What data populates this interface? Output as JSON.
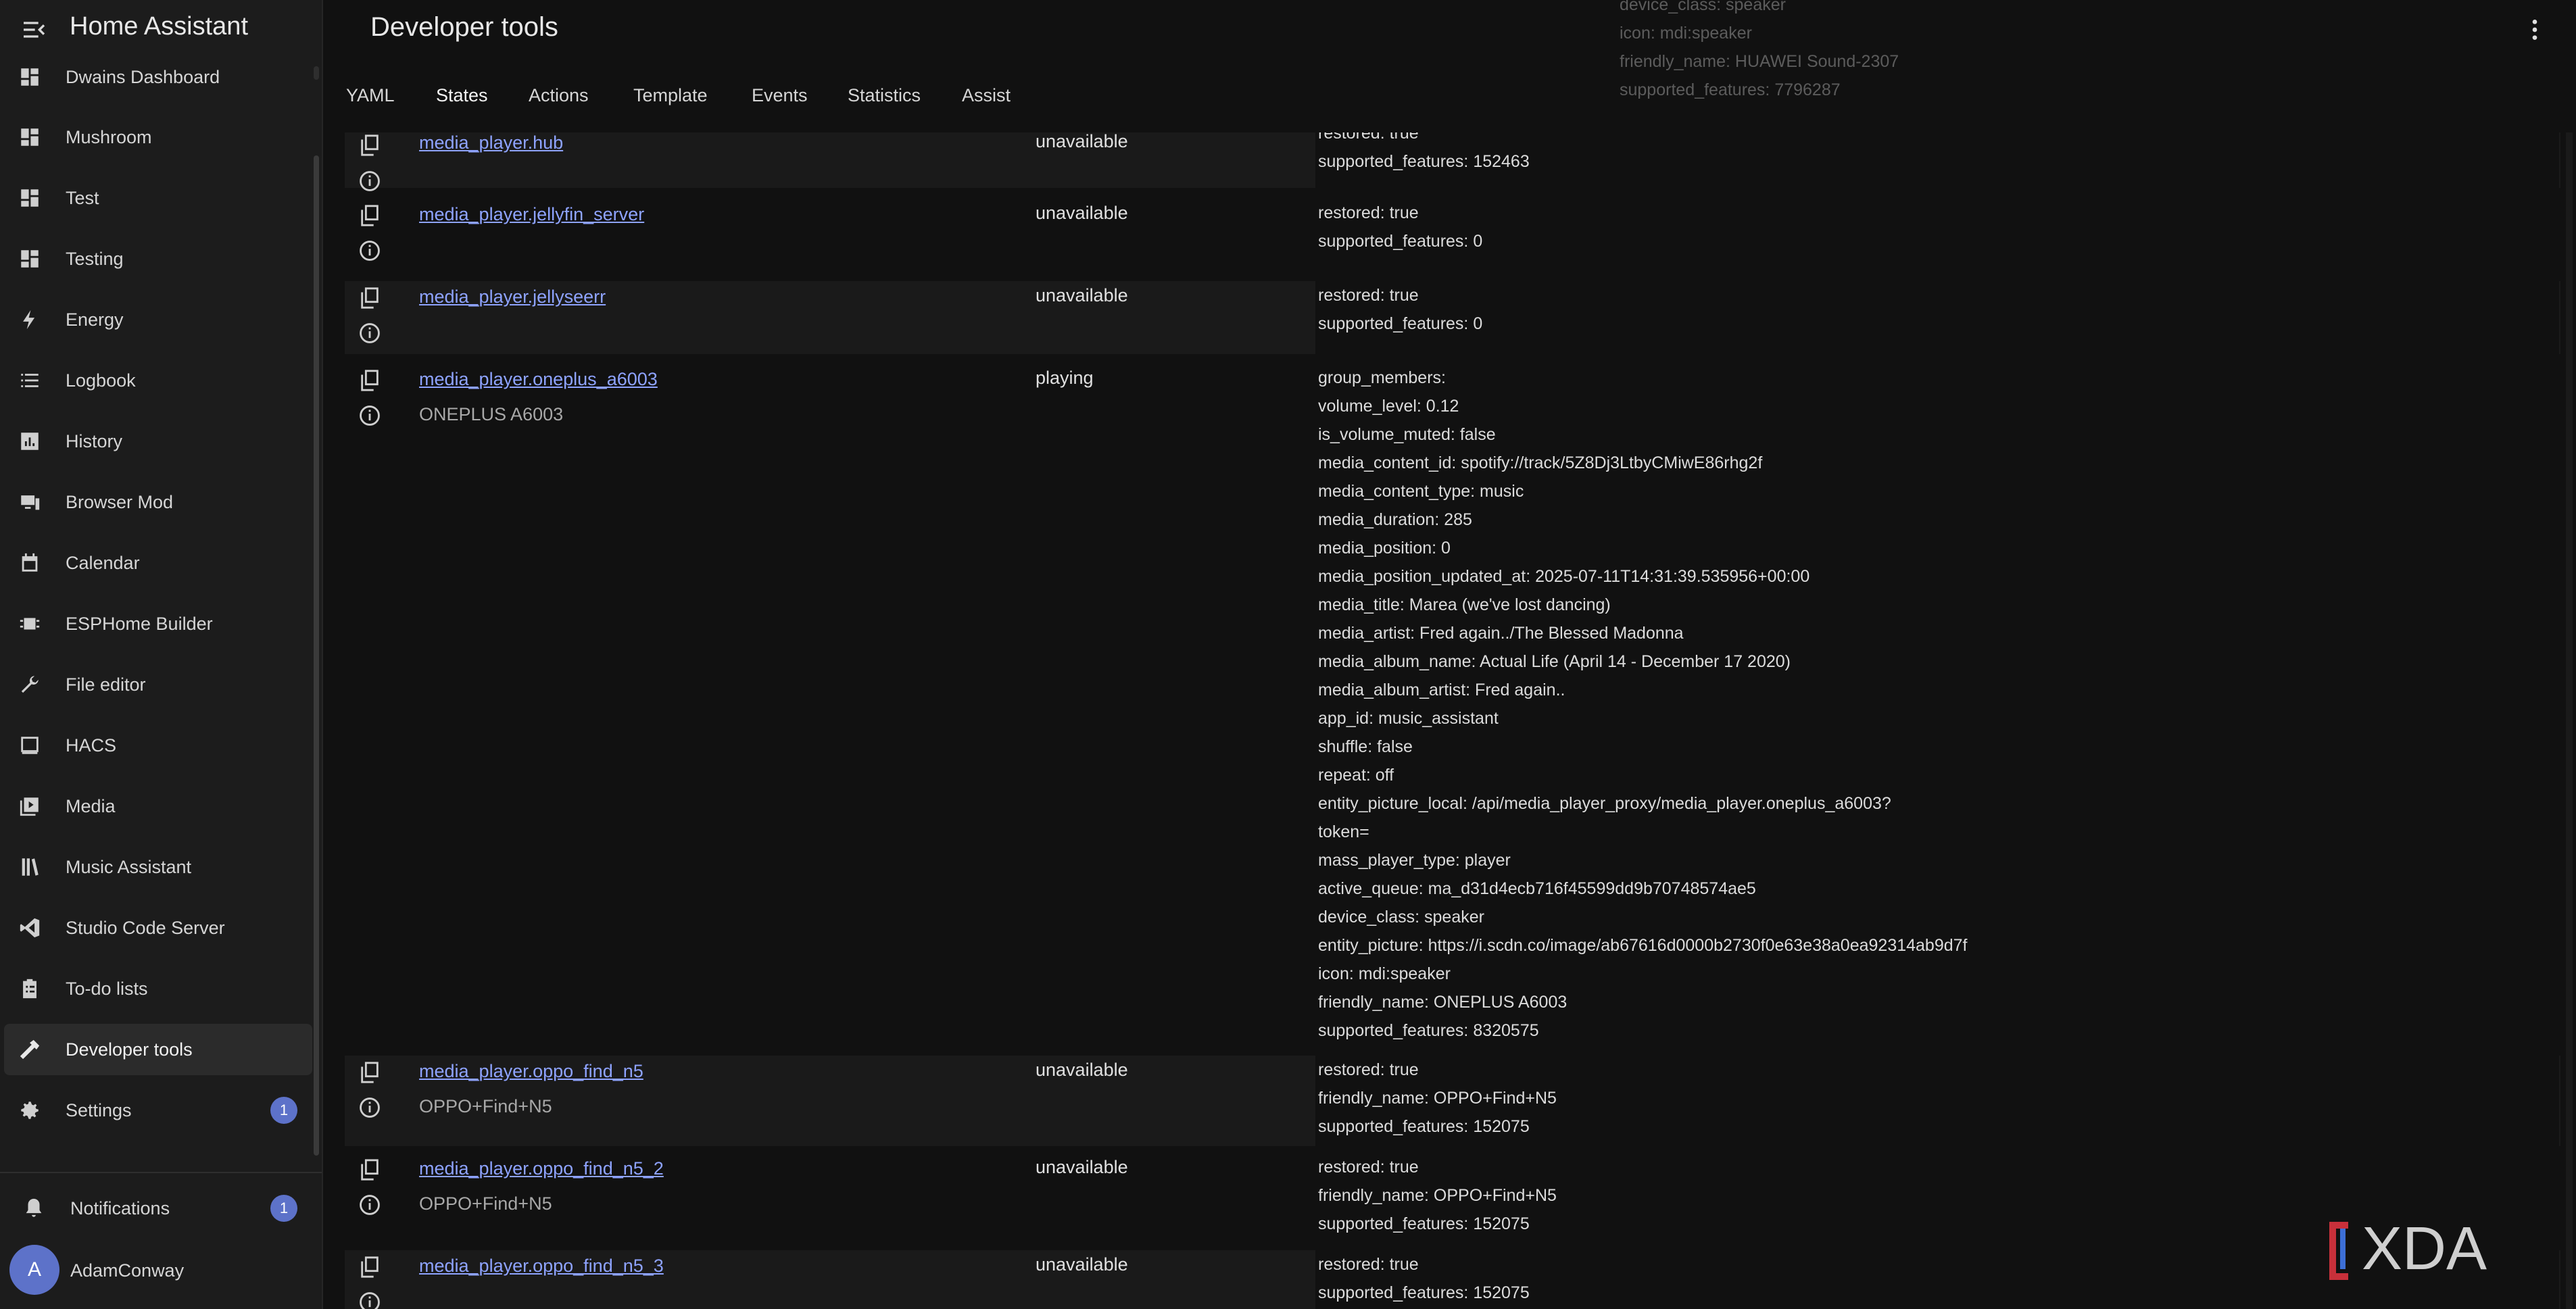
{
  "app": {
    "title": "Home Assistant"
  },
  "sidebar": {
    "items": [
      {
        "label": "Dwains Dashboard",
        "icon": "dashboard-icon"
      },
      {
        "label": "Mushroom",
        "icon": "dashboard-icon"
      },
      {
        "label": "Test",
        "icon": "dashboard-icon"
      },
      {
        "label": "Testing",
        "icon": "dashboard-icon"
      },
      {
        "label": "Energy",
        "icon": "lightning-bolt-icon"
      },
      {
        "label": "Logbook",
        "icon": "list-icon"
      },
      {
        "label": "History",
        "icon": "chart-box-icon"
      },
      {
        "label": "Browser Mod",
        "icon": "devices-icon"
      },
      {
        "label": "Calendar",
        "icon": "calendar-icon"
      },
      {
        "label": "ESPHome Builder",
        "icon": "chip-icon"
      },
      {
        "label": "File editor",
        "icon": "wrench-icon"
      },
      {
        "label": "HACS",
        "icon": "hacs-icon"
      },
      {
        "label": "Media",
        "icon": "play-box-icon"
      },
      {
        "label": "Music Assistant",
        "icon": "library-icon"
      },
      {
        "label": "Studio Code Server",
        "icon": "vscode-icon"
      },
      {
        "label": "To-do lists",
        "icon": "clipboard-list-icon"
      },
      {
        "label": "Developer tools",
        "icon": "hammer-icon"
      },
      {
        "label": "Settings",
        "icon": "cog-icon",
        "badge": "1"
      }
    ],
    "notifications": {
      "label": "Notifications",
      "badge": "1"
    },
    "user": {
      "name": "AdamConway",
      "initial": "A"
    }
  },
  "page": {
    "title": "Developer tools",
    "tabs": [
      "YAML",
      "States",
      "Actions",
      "Template",
      "Events",
      "Statistics",
      "Assist"
    ],
    "active_tab": "States"
  },
  "ghost_attrs": [
    "device_class: speaker",
    "icon: mdi:speaker",
    "friendly_name: HUAWEI Sound-2307",
    "supported_features: 7796287"
  ],
  "rows": [
    {
      "entity": "media_player.hub",
      "friendly_name": "",
      "state": "unavailable",
      "attributes": [
        "restored: true",
        "supported_features: 152463"
      ]
    },
    {
      "entity": "media_player.jellyfin_server",
      "friendly_name": "",
      "state": "unavailable",
      "attributes": [
        "restored: true",
        "supported_features: 0"
      ]
    },
    {
      "entity": "media_player.jellyseerr",
      "friendly_name": "",
      "state": "unavailable",
      "attributes": [
        "restored: true",
        "supported_features: 0"
      ]
    },
    {
      "entity": "media_player.oneplus_a6003",
      "friendly_name": "ONEPLUS A6003",
      "state": "playing",
      "attributes": [
        "group_members:",
        "volume_level: 0.12",
        "is_volume_muted: false",
        "media_content_id: spotify://track/5Z8Dj3LtbyCMiwE86rhg2f",
        "media_content_type: music",
        "media_duration: 285",
        "media_position: 0",
        "media_position_updated_at: 2025-07-11T14:31:39.535956+00:00",
        "media_title: Marea (we've lost dancing)",
        "media_artist: Fred again../The Blessed Madonna",
        "media_album_name: Actual Life (April 14 - December 17 2020)",
        "media_album_artist: Fred again..",
        "app_id: music_assistant",
        "shuffle: false",
        "repeat: off",
        "entity_picture_local: /api/media_player_proxy/media_player.oneplus_a6003?",
        "token=",
        "mass_player_type: player",
        "active_queue: ma_d31d4ecb716f45599dd9b70748574ae5",
        "device_class: speaker",
        "entity_picture: https://i.scdn.co/image/ab67616d0000b2730f0e63e38a0ea92314ab9d7f",
        "icon: mdi:speaker",
        "friendly_name: ONEPLUS A6003",
        "supported_features: 8320575"
      ]
    },
    {
      "entity": "media_player.oppo_find_n5",
      "friendly_name": "OPPO+Find+N5",
      "state": "unavailable",
      "attributes": [
        "restored: true",
        "friendly_name: OPPO+Find+N5",
        "supported_features: 152075"
      ]
    },
    {
      "entity": "media_player.oppo_find_n5_2",
      "friendly_name": "OPPO+Find+N5",
      "state": "unavailable",
      "attributes": [
        "restored: true",
        "friendly_name: OPPO+Find+N5",
        "supported_features: 152075"
      ]
    },
    {
      "entity": "media_player.oppo_find_n5_3",
      "friendly_name": "",
      "state": "unavailable",
      "attributes": [
        "restored: true",
        "supported_features: 152075"
      ]
    }
  ],
  "watermark": {
    "text": "XDA",
    "colors": {
      "bracket_red": "#c8303a",
      "bracket_blue": "#3d6fd6",
      "text": "#cfcfcf"
    }
  },
  "colors": {
    "accent": "#5d72c9",
    "link": "#8ea3ff",
    "background": "#111111",
    "sidebar": "#1c1c1c"
  }
}
